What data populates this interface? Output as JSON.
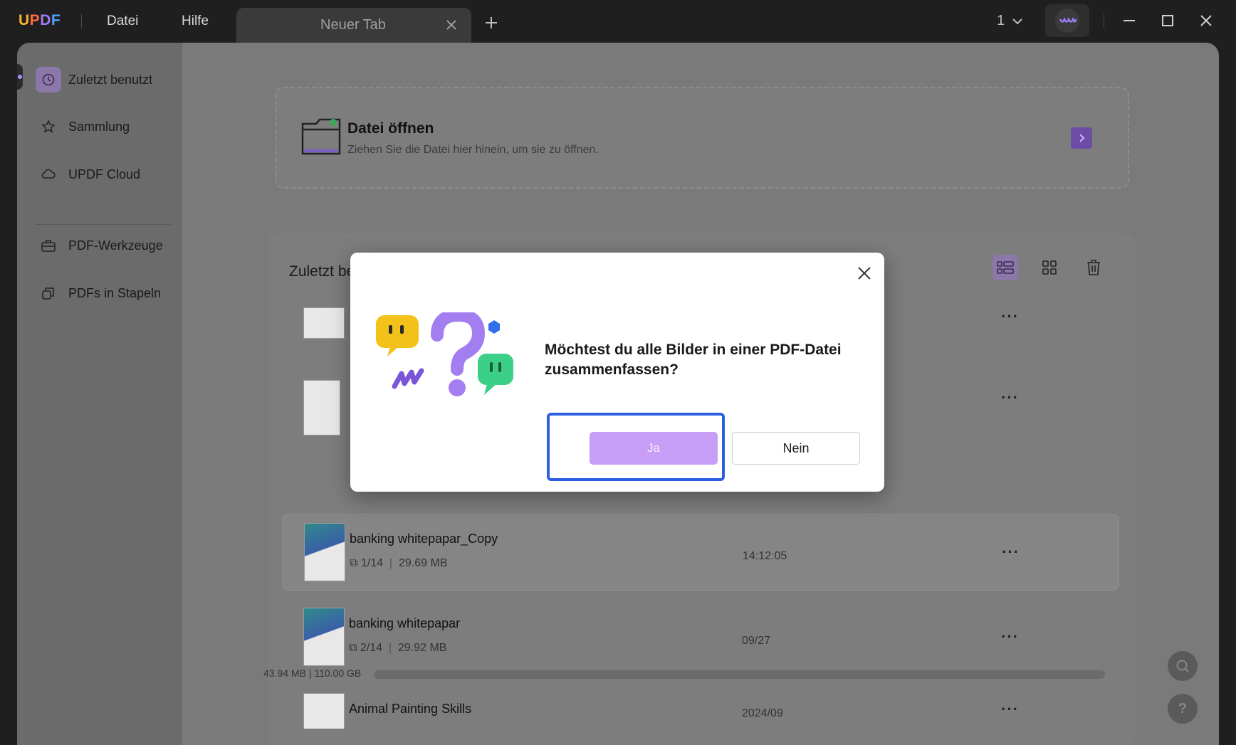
{
  "titlebar": {
    "logo": "UPDF",
    "menu": [
      "Datei",
      "Hilfe"
    ],
    "tab_label": "Neuer Tab",
    "window_count": "1"
  },
  "sidebar": {
    "items": [
      {
        "label": "Zuletzt benutzt",
        "icon": "clock-icon",
        "active": true
      },
      {
        "label": "Sammlung",
        "icon": "star-icon"
      },
      {
        "label": "UPDF Cloud",
        "icon": "cloud-icon"
      },
      {
        "label": "PDF-Werkzeuge",
        "icon": "briefcase-icon"
      },
      {
        "label": "PDFs in Stapeln",
        "icon": "stack-icon"
      }
    ]
  },
  "open_file": {
    "title": "Datei öffnen",
    "subtitle": "Ziehen Sie die Datei hier hinein, um sie zu öffnen."
  },
  "recent": {
    "title": "Zuletzt be",
    "files": [
      {
        "name": "",
        "meta": "",
        "date": ""
      },
      {
        "name": "",
        "meta": "",
        "date": ""
      },
      {
        "name": "banking whitepapar_Copy",
        "pages": "1/14",
        "size": "29.69 MB",
        "date": "14:12:05"
      },
      {
        "name": "banking whitepapar",
        "pages": "2/14",
        "size": "29.92 MB",
        "date": "09/27"
      },
      {
        "name": "Animal Painting Skills",
        "pages": "",
        "size": "",
        "date": "2024/09"
      }
    ],
    "storage": "43.94 MB | 110.00 GB"
  },
  "dialog": {
    "question": "Möchtest du alle Bilder in einer PDF-Datei zusammenfassen?",
    "yes_label": "Ja",
    "no_label": "Nein"
  },
  "colors": {
    "accent": "#c79df5",
    "focus": "#2b5fe0",
    "active_nav": "#8c78a8"
  }
}
